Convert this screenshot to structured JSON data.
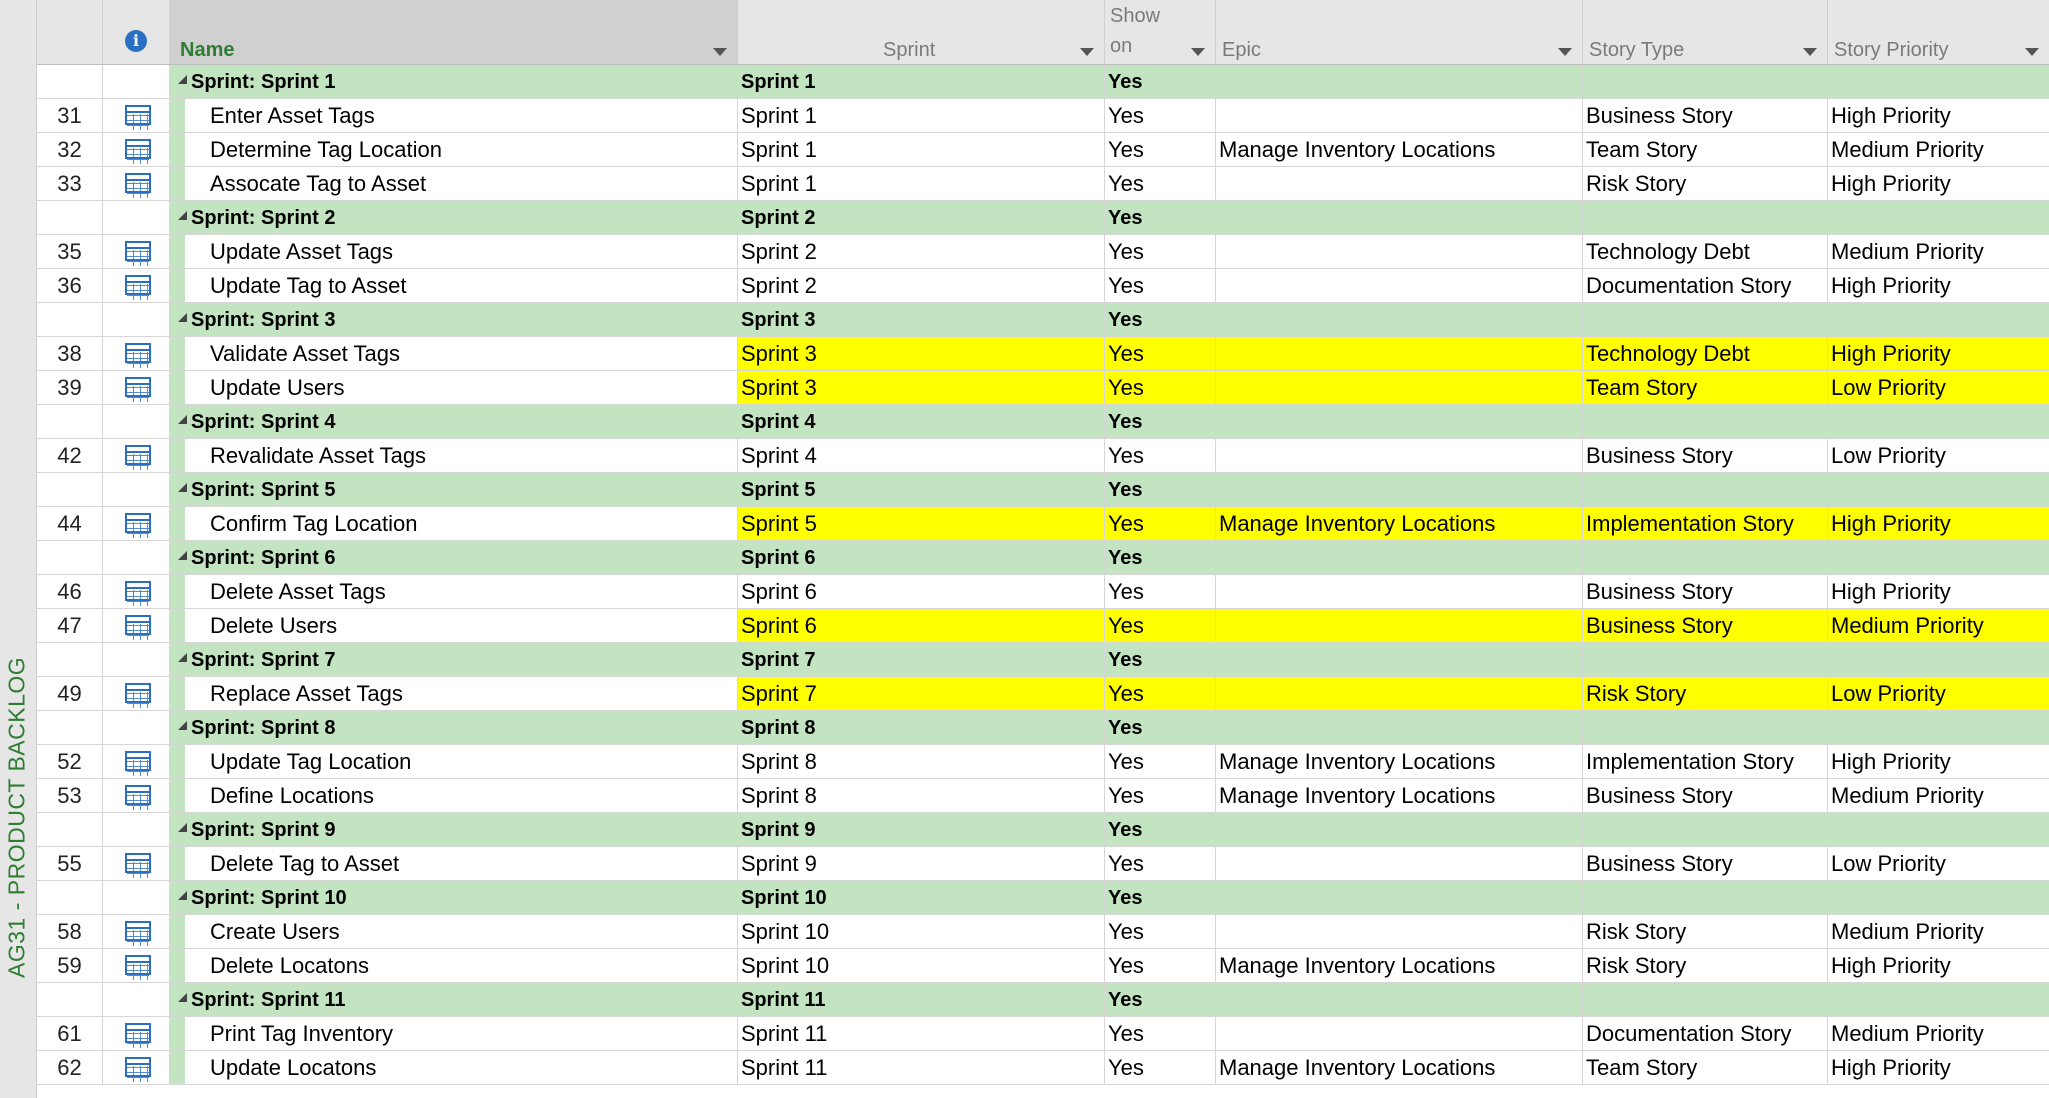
{
  "sidebar": {
    "label": "AG31 - PRODUCT BACKLOG"
  },
  "columns": {
    "info": "i",
    "name": "Name",
    "sprint": "Sprint",
    "show_on": "Show on",
    "epic": "Epic",
    "story_type": "Story Type",
    "story_priority": "Story Priority"
  },
  "rows": [
    {
      "kind": "summary",
      "id": "",
      "name": "Sprint: Sprint 1",
      "sprint": "Sprint 1",
      "show": "Yes",
      "epic": "",
      "type": "",
      "priority": ""
    },
    {
      "kind": "task",
      "id": "31",
      "name": "Enter Asset Tags",
      "sprint": "Sprint 1",
      "show": "Yes",
      "epic": "",
      "type": "Business Story",
      "priority": "High Priority",
      "hl": false
    },
    {
      "kind": "task",
      "id": "32",
      "name": "Determine Tag Location",
      "sprint": "Sprint 1",
      "show": "Yes",
      "epic": "Manage Inventory Locations",
      "type": "Team Story",
      "priority": "Medium Priority",
      "hl": false
    },
    {
      "kind": "task",
      "id": "33",
      "name": "Assocate Tag to Asset",
      "sprint": "Sprint 1",
      "show": "Yes",
      "epic": "",
      "type": "Risk Story",
      "priority": "High Priority",
      "hl": false
    },
    {
      "kind": "summary",
      "id": "",
      "name": "Sprint: Sprint 2",
      "sprint": "Sprint 2",
      "show": "Yes",
      "epic": "",
      "type": "",
      "priority": ""
    },
    {
      "kind": "task",
      "id": "35",
      "name": "Update Asset Tags",
      "sprint": "Sprint 2",
      "show": "Yes",
      "epic": "",
      "type": "Technology Debt",
      "priority": "Medium Priority",
      "hl": false
    },
    {
      "kind": "task",
      "id": "36",
      "name": "Update Tag to Asset",
      "sprint": "Sprint 2",
      "show": "Yes",
      "epic": "",
      "type": "Documentation Story",
      "priority": "High Priority",
      "hl": false
    },
    {
      "kind": "summary",
      "id": "",
      "name": "Sprint: Sprint 3",
      "sprint": "Sprint 3",
      "show": "Yes",
      "epic": "",
      "type": "",
      "priority": ""
    },
    {
      "kind": "task",
      "id": "38",
      "name": "Validate Asset Tags",
      "sprint": "Sprint 3",
      "show": "Yes",
      "epic": "",
      "type": "Technology Debt",
      "priority": "High Priority",
      "hl": true
    },
    {
      "kind": "task",
      "id": "39",
      "name": "Update Users",
      "sprint": "Sprint 3",
      "show": "Yes",
      "epic": "",
      "type": "Team Story",
      "priority": "Low Priority",
      "hl": true
    },
    {
      "kind": "summary",
      "id": "",
      "name": "Sprint: Sprint 4",
      "sprint": "Sprint 4",
      "show": "Yes",
      "epic": "",
      "type": "",
      "priority": ""
    },
    {
      "kind": "task",
      "id": "42",
      "name": "Revalidate Asset Tags",
      "sprint": "Sprint 4",
      "show": "Yes",
      "epic": "",
      "type": "Business Story",
      "priority": "Low Priority",
      "hl": false
    },
    {
      "kind": "summary",
      "id": "",
      "name": "Sprint: Sprint 5",
      "sprint": "Sprint 5",
      "show": "Yes",
      "epic": "",
      "type": "",
      "priority": ""
    },
    {
      "kind": "task",
      "id": "44",
      "name": "Confirm Tag Location",
      "sprint": "Sprint 5",
      "show": "Yes",
      "epic": "Manage Inventory Locations",
      "type": "Implementation Story",
      "priority": "High Priority",
      "hl": true
    },
    {
      "kind": "summary",
      "id": "",
      "name": "Sprint: Sprint 6",
      "sprint": "Sprint 6",
      "show": "Yes",
      "epic": "",
      "type": "",
      "priority": ""
    },
    {
      "kind": "task",
      "id": "46",
      "name": "Delete Asset Tags",
      "sprint": "Sprint 6",
      "show": "Yes",
      "epic": "",
      "type": "Business Story",
      "priority": "High Priority",
      "hl": false
    },
    {
      "kind": "task",
      "id": "47",
      "name": "Delete Users",
      "sprint": "Sprint 6",
      "show": "Yes",
      "epic": "",
      "type": "Business Story",
      "priority": "Medium Priority",
      "hl": true
    },
    {
      "kind": "summary",
      "id": "",
      "name": "Sprint: Sprint 7",
      "sprint": "Sprint 7",
      "show": "Yes",
      "epic": "",
      "type": "",
      "priority": ""
    },
    {
      "kind": "task",
      "id": "49",
      "name": "Replace Asset Tags",
      "sprint": "Sprint 7",
      "show": "Yes",
      "epic": "",
      "type": "Risk Story",
      "priority": "Low Priority",
      "hl": true
    },
    {
      "kind": "summary",
      "id": "",
      "name": "Sprint: Sprint 8",
      "sprint": "Sprint 8",
      "show": "Yes",
      "epic": "",
      "type": "",
      "priority": ""
    },
    {
      "kind": "task",
      "id": "52",
      "name": "Update Tag Location",
      "sprint": "Sprint 8",
      "show": "Yes",
      "epic": "Manage Inventory Locations",
      "type": "Implementation Story",
      "priority": "High Priority",
      "hl": false
    },
    {
      "kind": "task",
      "id": "53",
      "name": "Define Locations",
      "sprint": "Sprint 8",
      "show": "Yes",
      "epic": "Manage Inventory Locations",
      "type": "Business Story",
      "priority": "Medium Priority",
      "hl": false
    },
    {
      "kind": "summary",
      "id": "",
      "name": "Sprint: Sprint 9",
      "sprint": "Sprint 9",
      "show": "Yes",
      "epic": "",
      "type": "",
      "priority": ""
    },
    {
      "kind": "task",
      "id": "55",
      "name": "Delete Tag to Asset",
      "sprint": "Sprint 9",
      "show": "Yes",
      "epic": "",
      "type": "Business Story",
      "priority": "Low Priority",
      "hl": false
    },
    {
      "kind": "summary",
      "id": "",
      "name": "Sprint: Sprint 10",
      "sprint": "Sprint 10",
      "show": "Yes",
      "epic": "",
      "type": "",
      "priority": ""
    },
    {
      "kind": "task",
      "id": "58",
      "name": "Create Users",
      "sprint": "Sprint 10",
      "show": "Yes",
      "epic": "",
      "type": "Risk Story",
      "priority": "Medium Priority",
      "hl": false
    },
    {
      "kind": "task",
      "id": "59",
      "name": "Delete Locatons",
      "sprint": "Sprint 10",
      "show": "Yes",
      "epic": "Manage Inventory Locations",
      "type": "Risk Story",
      "priority": "High Priority",
      "hl": false
    },
    {
      "kind": "summary",
      "id": "",
      "name": "Sprint: Sprint 11",
      "sprint": "Sprint 11",
      "show": "Yes",
      "epic": "",
      "type": "",
      "priority": ""
    },
    {
      "kind": "task",
      "id": "61",
      "name": "Print Tag Inventory",
      "sprint": "Sprint 11",
      "show": "Yes",
      "epic": "",
      "type": "Documentation Story",
      "priority": "Medium Priority",
      "hl": false
    },
    {
      "kind": "task",
      "id": "62",
      "name": "Update Locatons",
      "sprint": "Sprint 11",
      "show": "Yes",
      "epic": "Manage Inventory Locations",
      "type": "Team Story",
      "priority": "High Priority",
      "hl": false
    }
  ],
  "colors": {
    "summary": "#c2e4c0",
    "highlight": "#ffff00",
    "accent": "#2e7d32"
  }
}
